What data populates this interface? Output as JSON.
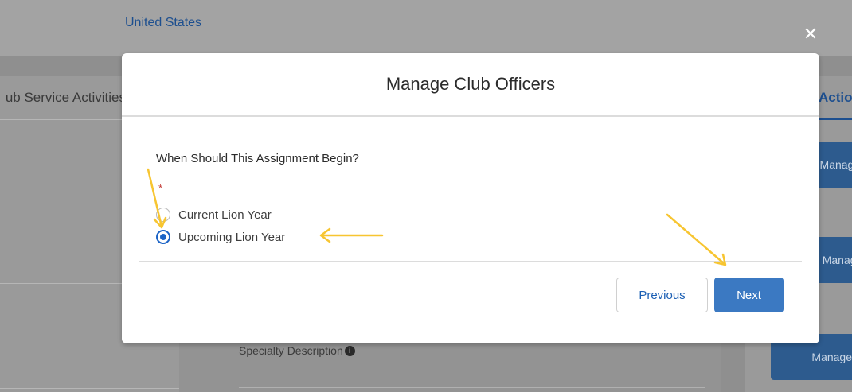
{
  "background": {
    "country": "United States",
    "left_panel_title": "Club Service Activities",
    "right_panel_title": "Actions",
    "right_buttons": [
      "Manage Officers",
      "Manage Club",
      "Manage"
    ],
    "specialty_label": "Specialty Description",
    "close_icon": "close-icon"
  },
  "modal": {
    "title": "Manage Club Officers",
    "question": "When Should This Assignment Begin?",
    "required_marker": "*",
    "options": [
      {
        "label": "Current Lion Year",
        "selected": false
      },
      {
        "label": "Upcoming Lion Year",
        "selected": true
      }
    ],
    "buttons": {
      "previous": "Previous",
      "next": "Next"
    }
  },
  "colors": {
    "brand_blue": "#3b79c2",
    "radio_selected": "#1b63c6",
    "annotation_arrow": "#f7c531"
  }
}
